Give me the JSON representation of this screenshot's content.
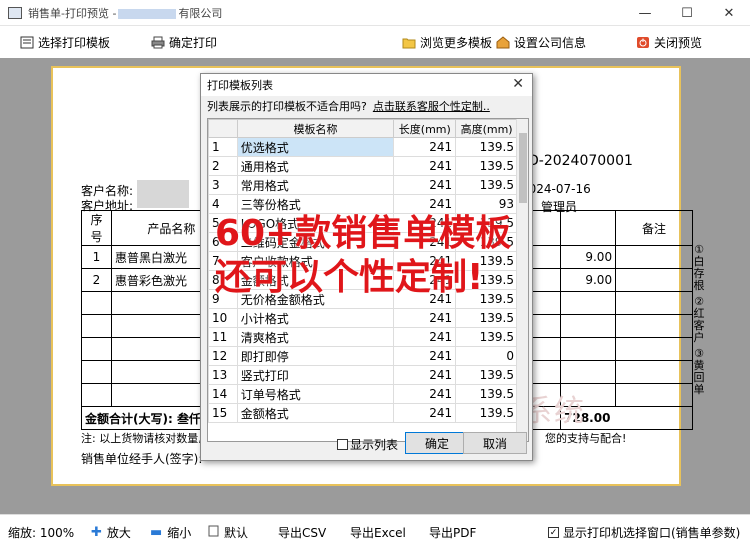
{
  "window": {
    "title_prefix": "销售单-打印预览 -",
    "title_suffix": "有限公司",
    "minimize": "—",
    "maximize": "☐",
    "close": "✕"
  },
  "toolbar": {
    "select_template": "选择打印模板",
    "confirm_print": "确定打印",
    "browse_more": "浏览更多模板",
    "company_settings": "设置公司信息",
    "close_preview": "关闭预览"
  },
  "document": {
    "doc_no": "D-2024070001",
    "date": "2024-07-16",
    "operator": "管理员",
    "customer_name_label": "客户名称:",
    "customer_address_label": "客户地址:",
    "headers": {
      "seq": "序号",
      "product": "产品名称",
      "remark": "备注"
    },
    "rows": [
      {
        "seq": "1",
        "product": "惠普黑白激光",
        "amount": "9.00"
      },
      {
        "seq": "2",
        "product": "惠普彩色激光",
        "amount": "9.00"
      }
    ],
    "total_label": "金额合计(大写): 叁仟",
    "total_amount": "728.00",
    "note": "注: 以上货物请核对数量,",
    "note_tail": "您的支持与配合!",
    "signer": "销售单位经手人(签字):",
    "side_notes": [
      "①白存根",
      "②红客户",
      "③黄回单"
    ],
    "watermark": "百惠销售单管理系统"
  },
  "dialog": {
    "title": "打印模板列表",
    "close": "✕",
    "hint": "列表展示的打印模板不适合用吗?",
    "hint_link": "点击联系客服个性定制..",
    "columns": [
      "模板名称",
      "长度(mm)",
      "高度(mm)"
    ],
    "rows": [
      {
        "no": "1",
        "name": "优选格式",
        "length": "241",
        "height": "139.5"
      },
      {
        "no": "2",
        "name": "通用格式",
        "length": "241",
        "height": "139.5"
      },
      {
        "no": "3",
        "name": "常用格式",
        "length": "241",
        "height": "139.5"
      },
      {
        "no": "4",
        "name": "三等份格式",
        "length": "241",
        "height": "93"
      },
      {
        "no": "5",
        "name": "LOGO格式",
        "length": "241",
        "height": "139.5"
      },
      {
        "no": "6",
        "name": "二维码定金格式",
        "length": "241",
        "height": "139.5"
      },
      {
        "no": "7",
        "name": "客户收款格式",
        "length": "241",
        "height": "139.5"
      },
      {
        "no": "8",
        "name": "金额格式",
        "length": "241",
        "height": "139.5"
      },
      {
        "no": "9",
        "name": "无价格金额格式",
        "length": "241",
        "height": "139.5"
      },
      {
        "no": "10",
        "name": "小计格式",
        "length": "241",
        "height": "139.5"
      },
      {
        "no": "11",
        "name": "清爽格式",
        "length": "241",
        "height": "139.5"
      },
      {
        "no": "12",
        "name": "即打即停",
        "length": "241",
        "height": "0"
      },
      {
        "no": "13",
        "name": "竖式打印",
        "length": "241",
        "height": "139.5"
      },
      {
        "no": "14",
        "name": "订单号格式",
        "length": "241",
        "height": "139.5"
      },
      {
        "no": "15",
        "name": "金额格式",
        "length": "241",
        "height": "139.5"
      }
    ],
    "show_list": "显示列表",
    "ok": "确定",
    "cancel": "取消"
  },
  "promo": {
    "line1": "60+款销售单模板",
    "line2": "还可以个性定制!"
  },
  "statusbar": {
    "zoom": "缩放: 100%",
    "zoom_in": "放大",
    "zoom_out": "缩小",
    "default": "默认",
    "export_csv": "导出CSV",
    "export_excel": "导出Excel",
    "export_pdf": "导出PDF",
    "show_printer": "显示打印机选择窗口(销售单参数)"
  }
}
